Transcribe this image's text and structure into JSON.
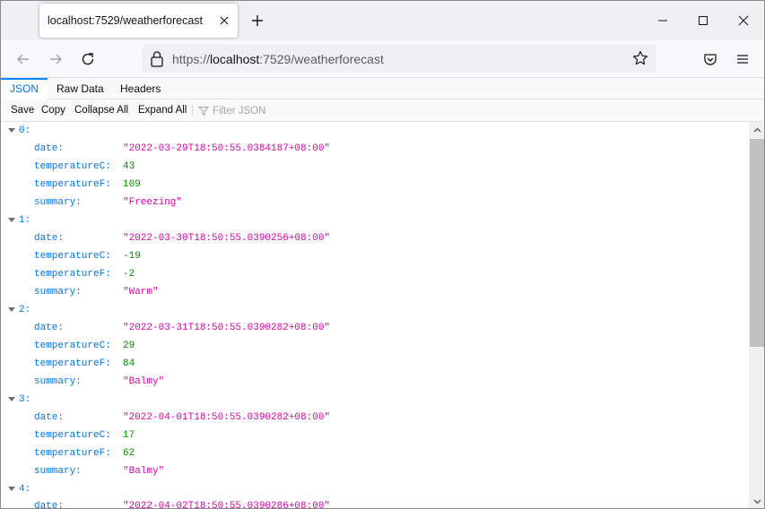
{
  "browser": {
    "tab_title": "localhost:7529/weatherforecast",
    "url_prefix": "https://",
    "url_host": "localhost",
    "url_rest": ":7529/weatherforecast"
  },
  "viewer": {
    "tabs": [
      "JSON",
      "Raw Data",
      "Headers"
    ],
    "toolbar": {
      "save": "Save",
      "copy": "Copy",
      "collapse_all": "Collapse All",
      "expand_all": "Expand All",
      "filter_placeholder": "Filter JSON"
    }
  },
  "json": {
    "items": [
      {
        "index": "0:",
        "date": "\"2022-03-29T18:50:55.0384187+08:00\"",
        "temperatureC": "43",
        "temperatureF": "109",
        "summary": "\"Freezing\""
      },
      {
        "index": "1:",
        "date": "\"2022-03-30T18:50:55.0390256+08:00\"",
        "temperatureC": "-19",
        "temperatureF": "-2",
        "summary": "\"Warm\""
      },
      {
        "index": "2:",
        "date": "\"2022-03-31T18:50:55.0390282+08:00\"",
        "temperatureC": "29",
        "temperatureF": "84",
        "summary": "\"Balmy\""
      },
      {
        "index": "3:",
        "date": "\"2022-04-01T18:50:55.0390282+08:00\"",
        "temperatureC": "17",
        "temperatureF": "62",
        "summary": "\"Balmy\""
      },
      {
        "index": "4:",
        "date": "\"2022-04-02T18:50:55.0390286+08:00\""
      }
    ],
    "keys": {
      "date": "date:",
      "temperatureC": "temperatureC:",
      "temperatureF": "temperatureF:",
      "summary": "summary:"
    }
  },
  "colors": {
    "key": "#0074e8",
    "string": "#dd00a9",
    "number": "#058b00",
    "active_tab": "#0a84ff"
  }
}
